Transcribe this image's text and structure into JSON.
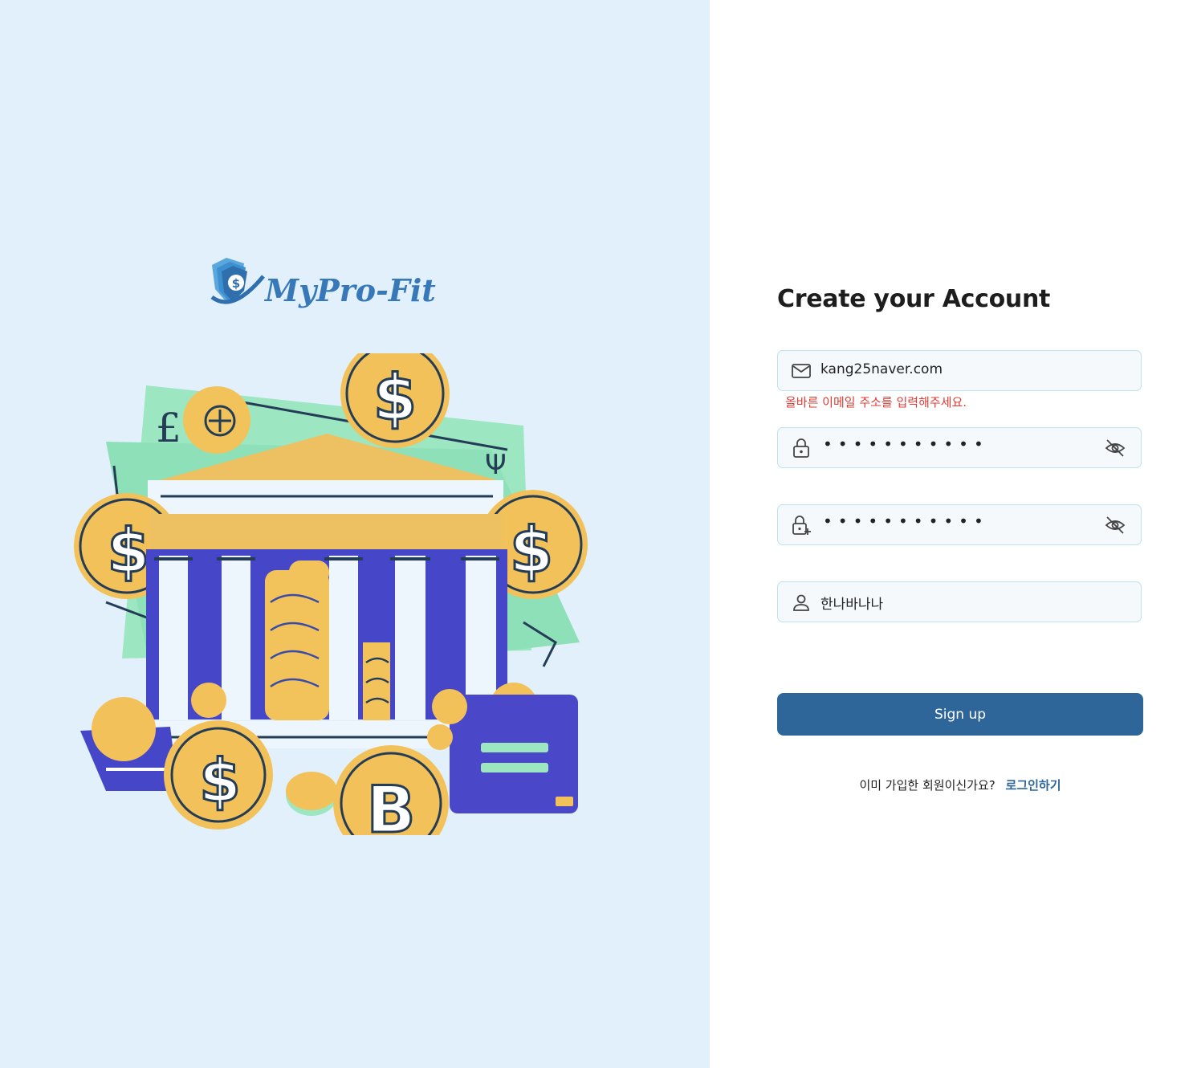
{
  "brand": {
    "name": "MyPro-Fit",
    "logo_icon": "shield-dollar-icon"
  },
  "illustration": {
    "icon": "bank-coins-illustration"
  },
  "form": {
    "title": "Create your Account",
    "email": {
      "icon": "mail-icon",
      "value": "kang25naver.com",
      "error": "올바른 이메일 주소를 입력해주세요."
    },
    "password": {
      "icon": "lock-icon",
      "masked_value": "•••••••••••",
      "toggle_icon": "eye-off-icon"
    },
    "password_confirm": {
      "icon": "lock-plus-icon",
      "masked_value": "•••••••••••",
      "toggle_icon": "eye-off-icon"
    },
    "nickname": {
      "icon": "user-icon",
      "value": "한나바나나"
    },
    "submit_label": "Sign up",
    "footer": {
      "question": "이미 가입한 회원이신가요?",
      "login_link": "로그인하기"
    }
  },
  "colors": {
    "left_bg": "#e1f0fb",
    "primary": "#2e6699",
    "error": "#e03b35",
    "input_border": "#bde2f5",
    "input_bg": "#f6f9fc"
  }
}
